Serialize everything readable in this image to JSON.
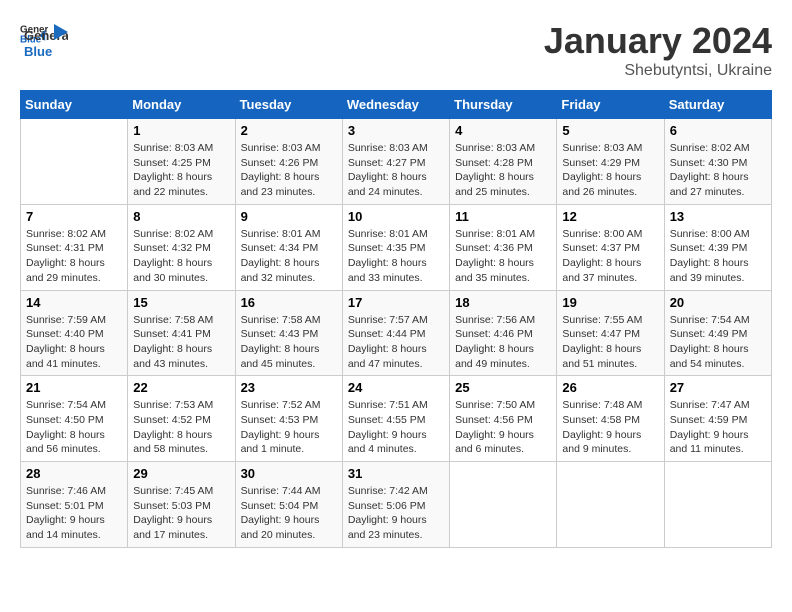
{
  "header": {
    "logo_general": "General",
    "logo_blue": "Blue",
    "month": "January 2024",
    "location": "Shebutyntsi, Ukraine"
  },
  "days_of_week": [
    "Sunday",
    "Monday",
    "Tuesday",
    "Wednesday",
    "Thursday",
    "Friday",
    "Saturday"
  ],
  "weeks": [
    [
      {
        "day": "",
        "sunrise": "",
        "sunset": "",
        "daylight": ""
      },
      {
        "day": "1",
        "sunrise": "Sunrise: 8:03 AM",
        "sunset": "Sunset: 4:25 PM",
        "daylight": "Daylight: 8 hours and 22 minutes."
      },
      {
        "day": "2",
        "sunrise": "Sunrise: 8:03 AM",
        "sunset": "Sunset: 4:26 PM",
        "daylight": "Daylight: 8 hours and 23 minutes."
      },
      {
        "day": "3",
        "sunrise": "Sunrise: 8:03 AM",
        "sunset": "Sunset: 4:27 PM",
        "daylight": "Daylight: 8 hours and 24 minutes."
      },
      {
        "day": "4",
        "sunrise": "Sunrise: 8:03 AM",
        "sunset": "Sunset: 4:28 PM",
        "daylight": "Daylight: 8 hours and 25 minutes."
      },
      {
        "day": "5",
        "sunrise": "Sunrise: 8:03 AM",
        "sunset": "Sunset: 4:29 PM",
        "daylight": "Daylight: 8 hours and 26 minutes."
      },
      {
        "day": "6",
        "sunrise": "Sunrise: 8:02 AM",
        "sunset": "Sunset: 4:30 PM",
        "daylight": "Daylight: 8 hours and 27 minutes."
      }
    ],
    [
      {
        "day": "7",
        "sunrise": "Sunrise: 8:02 AM",
        "sunset": "Sunset: 4:31 PM",
        "daylight": "Daylight: 8 hours and 29 minutes."
      },
      {
        "day": "8",
        "sunrise": "Sunrise: 8:02 AM",
        "sunset": "Sunset: 4:32 PM",
        "daylight": "Daylight: 8 hours and 30 minutes."
      },
      {
        "day": "9",
        "sunrise": "Sunrise: 8:01 AM",
        "sunset": "Sunset: 4:34 PM",
        "daylight": "Daylight: 8 hours and 32 minutes."
      },
      {
        "day": "10",
        "sunrise": "Sunrise: 8:01 AM",
        "sunset": "Sunset: 4:35 PM",
        "daylight": "Daylight: 8 hours and 33 minutes."
      },
      {
        "day": "11",
        "sunrise": "Sunrise: 8:01 AM",
        "sunset": "Sunset: 4:36 PM",
        "daylight": "Daylight: 8 hours and 35 minutes."
      },
      {
        "day": "12",
        "sunrise": "Sunrise: 8:00 AM",
        "sunset": "Sunset: 4:37 PM",
        "daylight": "Daylight: 8 hours and 37 minutes."
      },
      {
        "day": "13",
        "sunrise": "Sunrise: 8:00 AM",
        "sunset": "Sunset: 4:39 PM",
        "daylight": "Daylight: 8 hours and 39 minutes."
      }
    ],
    [
      {
        "day": "14",
        "sunrise": "Sunrise: 7:59 AM",
        "sunset": "Sunset: 4:40 PM",
        "daylight": "Daylight: 8 hours and 41 minutes."
      },
      {
        "day": "15",
        "sunrise": "Sunrise: 7:58 AM",
        "sunset": "Sunset: 4:41 PM",
        "daylight": "Daylight: 8 hours and 43 minutes."
      },
      {
        "day": "16",
        "sunrise": "Sunrise: 7:58 AM",
        "sunset": "Sunset: 4:43 PM",
        "daylight": "Daylight: 8 hours and 45 minutes."
      },
      {
        "day": "17",
        "sunrise": "Sunrise: 7:57 AM",
        "sunset": "Sunset: 4:44 PM",
        "daylight": "Daylight: 8 hours and 47 minutes."
      },
      {
        "day": "18",
        "sunrise": "Sunrise: 7:56 AM",
        "sunset": "Sunset: 4:46 PM",
        "daylight": "Daylight: 8 hours and 49 minutes."
      },
      {
        "day": "19",
        "sunrise": "Sunrise: 7:55 AM",
        "sunset": "Sunset: 4:47 PM",
        "daylight": "Daylight: 8 hours and 51 minutes."
      },
      {
        "day": "20",
        "sunrise": "Sunrise: 7:54 AM",
        "sunset": "Sunset: 4:49 PM",
        "daylight": "Daylight: 8 hours and 54 minutes."
      }
    ],
    [
      {
        "day": "21",
        "sunrise": "Sunrise: 7:54 AM",
        "sunset": "Sunset: 4:50 PM",
        "daylight": "Daylight: 8 hours and 56 minutes."
      },
      {
        "day": "22",
        "sunrise": "Sunrise: 7:53 AM",
        "sunset": "Sunset: 4:52 PM",
        "daylight": "Daylight: 8 hours and 58 minutes."
      },
      {
        "day": "23",
        "sunrise": "Sunrise: 7:52 AM",
        "sunset": "Sunset: 4:53 PM",
        "daylight": "Daylight: 9 hours and 1 minute."
      },
      {
        "day": "24",
        "sunrise": "Sunrise: 7:51 AM",
        "sunset": "Sunset: 4:55 PM",
        "daylight": "Daylight: 9 hours and 4 minutes."
      },
      {
        "day": "25",
        "sunrise": "Sunrise: 7:50 AM",
        "sunset": "Sunset: 4:56 PM",
        "daylight": "Daylight: 9 hours and 6 minutes."
      },
      {
        "day": "26",
        "sunrise": "Sunrise: 7:48 AM",
        "sunset": "Sunset: 4:58 PM",
        "daylight": "Daylight: 9 hours and 9 minutes."
      },
      {
        "day": "27",
        "sunrise": "Sunrise: 7:47 AM",
        "sunset": "Sunset: 4:59 PM",
        "daylight": "Daylight: 9 hours and 11 minutes."
      }
    ],
    [
      {
        "day": "28",
        "sunrise": "Sunrise: 7:46 AM",
        "sunset": "Sunset: 5:01 PM",
        "daylight": "Daylight: 9 hours and 14 minutes."
      },
      {
        "day": "29",
        "sunrise": "Sunrise: 7:45 AM",
        "sunset": "Sunset: 5:03 PM",
        "daylight": "Daylight: 9 hours and 17 minutes."
      },
      {
        "day": "30",
        "sunrise": "Sunrise: 7:44 AM",
        "sunset": "Sunset: 5:04 PM",
        "daylight": "Daylight: 9 hours and 20 minutes."
      },
      {
        "day": "31",
        "sunrise": "Sunrise: 7:42 AM",
        "sunset": "Sunset: 5:06 PM",
        "daylight": "Daylight: 9 hours and 23 minutes."
      },
      {
        "day": "",
        "sunrise": "",
        "sunset": "",
        "daylight": ""
      },
      {
        "day": "",
        "sunrise": "",
        "sunset": "",
        "daylight": ""
      },
      {
        "day": "",
        "sunrise": "",
        "sunset": "",
        "daylight": ""
      }
    ]
  ]
}
